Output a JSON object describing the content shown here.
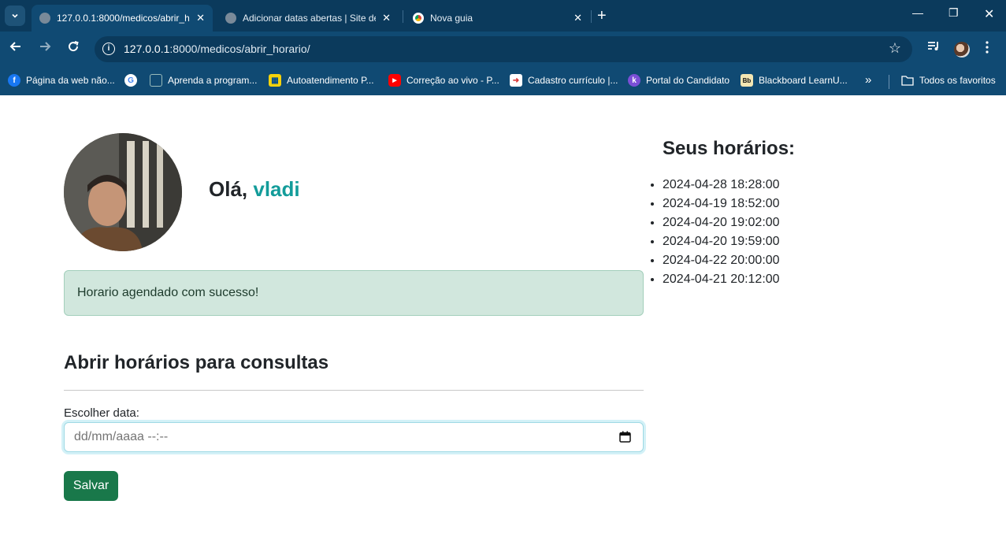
{
  "browser": {
    "tabs": [
      {
        "title": "127.0.0.1:8000/medicos/abrir_h",
        "active": true
      },
      {
        "title": "Adicionar datas abertas | Site de",
        "active": false
      },
      {
        "title": "Nova guia",
        "active": false
      }
    ],
    "url_host": "127.0.0.1",
    "url_rest": ":8000/medicos/abrir_horario/",
    "bookmarks": [
      {
        "label": "Página da web não...",
        "icon": "facebook-icon",
        "color": "#1877f2"
      },
      {
        "label": "",
        "icon": "google-icon",
        "color": "#ffffff"
      },
      {
        "label": "Aprenda a program...",
        "icon": "document-icon",
        "color": "#2b2b2b"
      },
      {
        "label": "Autoatendimento P...",
        "icon": "bank-icon",
        "color": "#f5d20b"
      },
      {
        "label": "Correção ao vivo - P...",
        "icon": "youtube-icon",
        "color": "#ff0000"
      },
      {
        "label": "Cadastro currículo |...",
        "icon": "form-icon",
        "color": "#d93a3a"
      },
      {
        "label": "Portal do Candidato",
        "icon": "portal-icon",
        "color": "#7b4fd6"
      },
      {
        "label": "Blackboard LearnU...",
        "icon": "blackboard-icon",
        "color": "#111111"
      }
    ],
    "all_bookmarks_label": "Todos os favoritos"
  },
  "page": {
    "greeting_prefix": "Olá,",
    "user_name": "vladi",
    "alert_message": "Horario agendado com sucesso!",
    "section_title": "Abrir horários para consultas",
    "date_label": "Escolher data:",
    "date_placeholder": "dd/mm/aaaa --:--",
    "save_label": "Salvar",
    "schedule_title": "Seus horários:",
    "schedules": [
      "2024-04-28 18:28:00",
      "2024-04-19 18:52:00",
      "2024-04-20 19:02:00",
      "2024-04-20 19:59:00",
      "2024-04-22 20:00:00",
      "2024-04-21 20:12:00"
    ]
  },
  "colors": {
    "chrome_dark": "#0b3a5c",
    "chrome_toolbar": "#104a73",
    "name_accent": "#139c9a",
    "alert_bg": "#d1e7dd",
    "save_button": "#19784a"
  }
}
